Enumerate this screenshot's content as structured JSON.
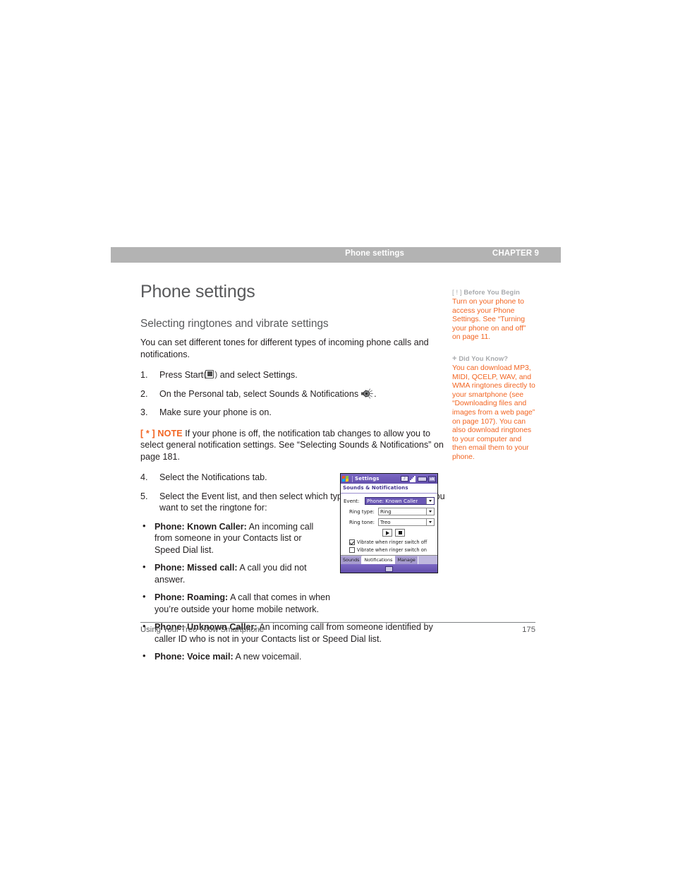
{
  "header": {
    "section": "Phone settings",
    "chapter": "CHAPTER 9"
  },
  "main": {
    "page_title": "Phone settings",
    "section_title": "Selecting ringtones and vibrate settings",
    "intro": "You can set different tones for different types of incoming phone calls and notifications.",
    "steps_1": [
      {
        "num": "1.",
        "text_before": "Press Start",
        "icon": "start-menu-icon",
        "text_after": "and select Settings."
      },
      {
        "num": "2.",
        "text_before": "On the Personal tab, select Sounds & Notifications",
        "icon": "speaker-sounds-icon",
        "text_after": "."
      },
      {
        "num": "3.",
        "text_before": "Make sure your phone is on.",
        "icon": "",
        "text_after": ""
      }
    ],
    "note": {
      "label": "[ * ] NOTE",
      "text": "If your phone is off, the notification tab changes to allow you to select general notification settings. See “Selecting Sounds & Notifications” on page 181."
    },
    "steps_2": [
      {
        "num": "4.",
        "text": "Select the Notifications tab."
      },
      {
        "num": "5.",
        "text": "Select the Event list, and then select which type of call or notification you want to set the ringtone for:"
      }
    ],
    "bullets": [
      {
        "bullet": "•",
        "term": "Phone: Known Caller:",
        "text": "An incoming call from someone in your Contacts list or Speed Dial list."
      },
      {
        "bullet": "•",
        "term": "Phone: Missed call:",
        "text": "A call you did not answer."
      },
      {
        "bullet": "•",
        "term": "Phone: Roaming:",
        "text": "A call that comes in when you’re outside your home mobile network."
      },
      {
        "bullet": "•",
        "term": "Phone: Unknown Caller:",
        "text": "An incoming call from someone identified by caller ID who is not in your Contacts list or Speed Dial list."
      },
      {
        "bullet": "•",
        "term": "Phone: Voice mail:",
        "text": "A new voicemail."
      }
    ]
  },
  "device": {
    "title": "Settings",
    "subtitle": "Sounds & Notifications",
    "tray": {
      "volume_badge": "♪",
      "ok_label": "ok"
    },
    "fields": [
      {
        "label": "Event:",
        "value": "Phone: Known Caller",
        "selected": true
      },
      {
        "label": "Ring type:",
        "value": "Ring",
        "selected": false
      },
      {
        "label": "Ring tone:",
        "value": "Treo",
        "selected": false
      }
    ],
    "buttons": [
      {
        "name": "play-button",
        "glyph": "play"
      },
      {
        "name": "stop-button",
        "glyph": "stop"
      }
    ],
    "checkboxes": [
      {
        "label": "Vibrate when ringer switch off",
        "checked": true
      },
      {
        "label": "Vibrate when ringer switch on",
        "checked": false
      }
    ],
    "tabs": [
      {
        "label": "Sounds",
        "active": false
      },
      {
        "label": "Notifications",
        "active": true
      },
      {
        "label": "Manage",
        "active": false
      }
    ]
  },
  "tips": [
    {
      "marker": "[ ! ]",
      "heading": "Before You Begin",
      "body": "Turn on your phone to access your Phone Settings. See “Turning your phone on and off” on page 11."
    },
    {
      "marker": "+",
      "heading": "Did You Know?",
      "body": "You can download MP3, MIDI, QCELP, WAV, and WMA ringtones directly to your smartphone (see “Downloading files and images from a web page” on page 107). You can also download ringtones to your computer and then email them to your phone."
    }
  ],
  "footer": {
    "book_title": "Using Your Treo 700w Smartphone",
    "page_number": "175"
  },
  "colors": {
    "accent_orange": "#f26522",
    "header_gray": "#b3b3b3",
    "title_gray": "#58595b",
    "tip_heading_gray": "#a7a9ac",
    "device_purple": "#6b58b5"
  }
}
